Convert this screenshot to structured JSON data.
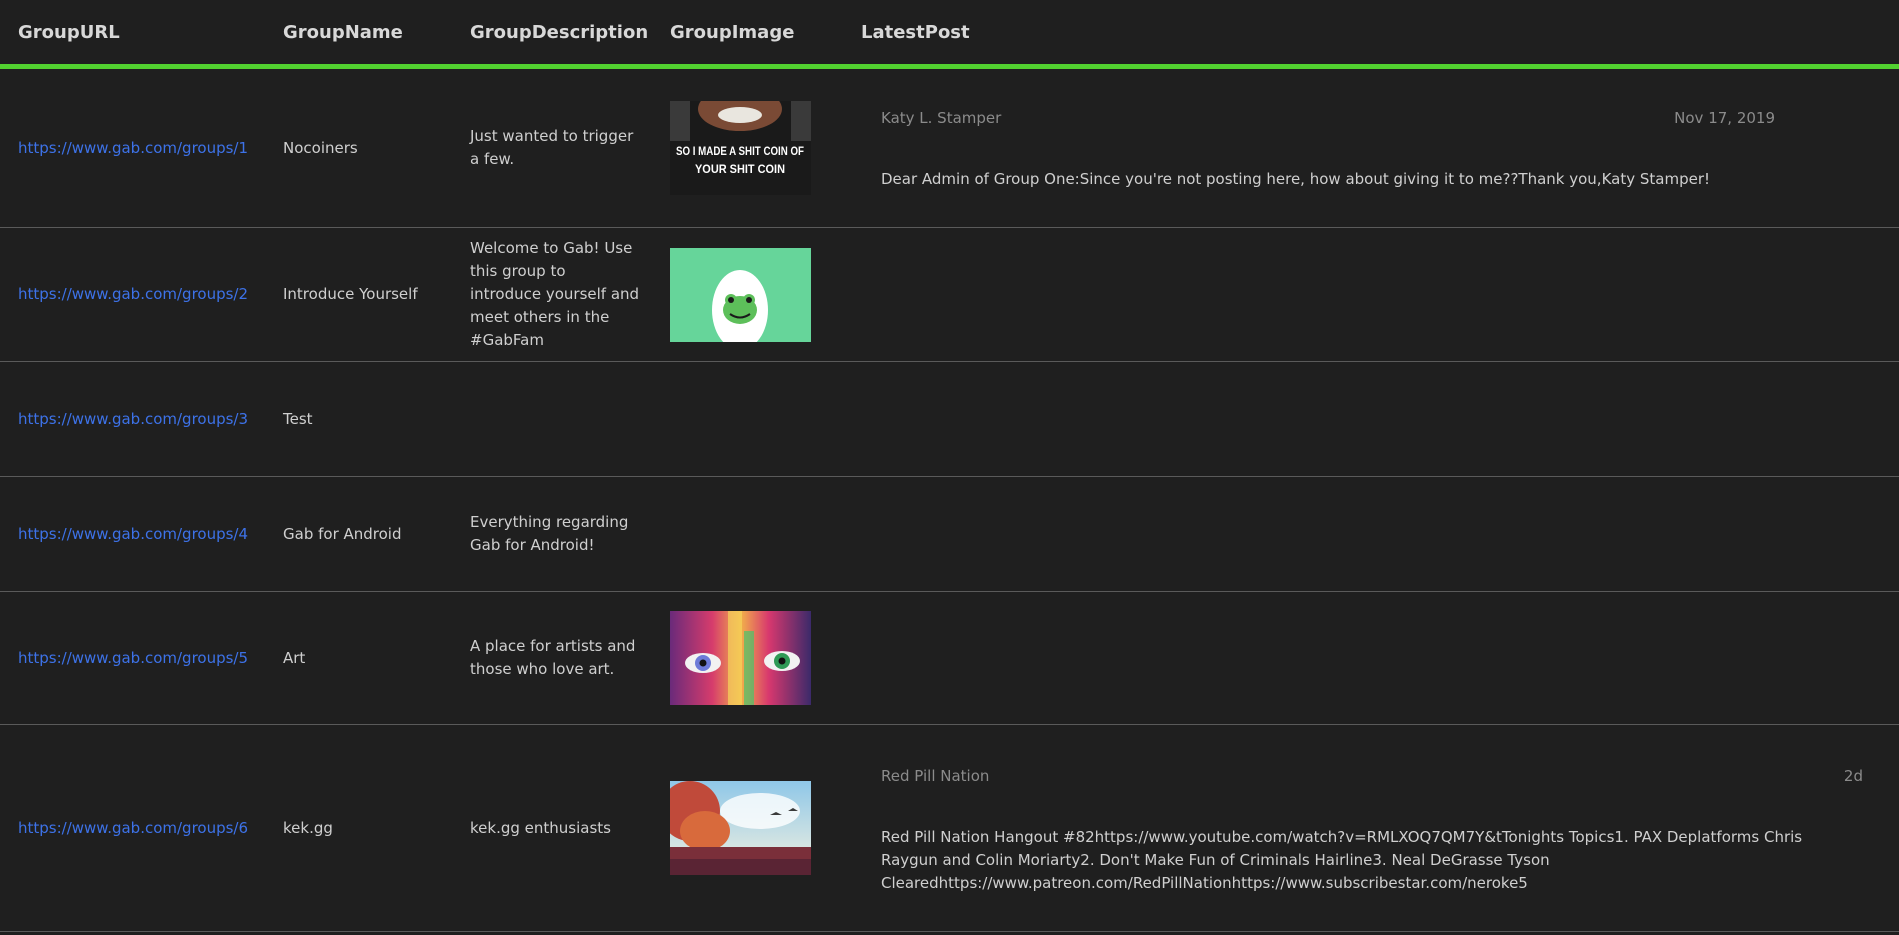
{
  "headers": {
    "url": "GroupURL",
    "name": "GroupName",
    "description": "GroupDescription",
    "image": "GroupImage",
    "post": "LatestPost"
  },
  "rows": [
    {
      "url": "https://www.gab.com/groups/1",
      "name": "Nocoiners",
      "description": "Just wanted to trigger a few.",
      "image_text": "SO I MADE A SHIT COIN OF YOUR SHIT COIN",
      "post_author": "Katy L. Stamper",
      "post_date": "Nov 17, 2019",
      "post_body": "Dear Admin of Group One:Since you're not posting here, how about giving it to me??Thank you,Katy Stamper!"
    },
    {
      "url": "https://www.gab.com/groups/2",
      "name": "Introduce Yourself",
      "description": "Welcome to Gab! Use this group to introduce yourself and meet others in the #GabFam"
    },
    {
      "url": "https://www.gab.com/groups/3",
      "name": "Test",
      "description": ""
    },
    {
      "url": "https://www.gab.com/groups/4",
      "name": "Gab for Android",
      "description": "Everything regarding Gab for Android!"
    },
    {
      "url": "https://www.gab.com/groups/5",
      "name": "Art",
      "description": "A place for artists and those who love art."
    },
    {
      "url": "https://www.gab.com/groups/6",
      "name": "kek.gg",
      "description": "kek.gg enthusiasts",
      "post_author": "Red Pill Nation",
      "post_date": "2d",
      "post_body": "Red Pill Nation Hangout #82https://www.youtube.com/watch?v=RMLXOQ7QM7Y&tTonights Topics1. PAX Deplatforms Chris Raygun and Colin Moriarty2. Don't Make Fun of Criminals Hairline3. Neal DeGrasse Tyson Clearedhttps://www.patreon.com/RedPillNationhttps://www.subscribestar.com/neroke5"
    }
  ],
  "colors": {
    "background": "#1f1f1f",
    "accent_line": "#52d130",
    "link": "#3d72e8",
    "divider": "#5a5a5a"
  }
}
